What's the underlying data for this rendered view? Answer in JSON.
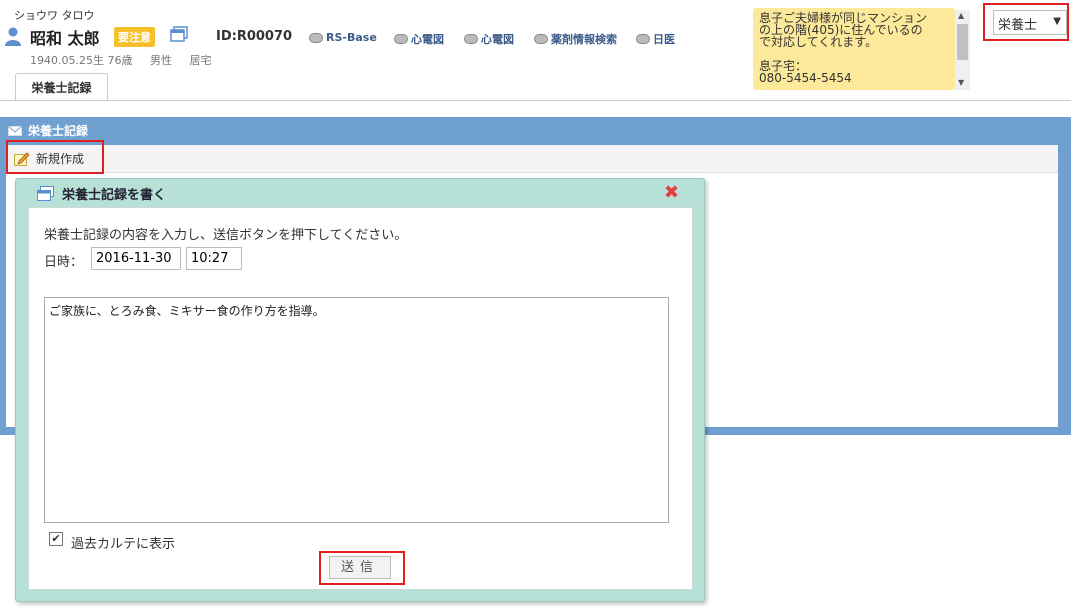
{
  "patient": {
    "kana": "ショウワ タロウ",
    "name": "昭和 太郎",
    "caution_badge": "要注意",
    "id": "ID:R00070",
    "birth": "1940.05.25生 76歳",
    "sex": "男性",
    "residence": "居宅"
  },
  "header_links": [
    "RS-Base",
    "心電図",
    "心電図",
    "薬剤情報検索",
    "日医"
  ],
  "memo": {
    "lines": [
      "息子ご夫婦様が同じマンション",
      "の上の階(405)に住んでいるの",
      "で対応してくれます。",
      "",
      "息子宅：",
      "080-5454-5454"
    ]
  },
  "role_select": {
    "value": "栄養士"
  },
  "tabs": [
    "栄養士記録"
  ],
  "section": {
    "title": "栄養士記録",
    "new_button": "新規作成"
  },
  "dialog": {
    "title": "栄養士記録を書く",
    "instruction": "栄養士記録の内容を入力し、送信ボタンを押下してください。",
    "datetime_label": "日時：",
    "date": "2016-11-30",
    "time": "10:27",
    "content": "ご家族に、とろみ食、ミキサー食の作り方を指導。",
    "show_past_label": "過去カルテに表示",
    "show_past_checked": true,
    "send_label": "送信"
  },
  "colors": {
    "accent_blue": "#6fa0d0",
    "caution": "#f6c02a",
    "memo": "#fde99a",
    "dialog": "#b7e0d6",
    "highlight": "#e02020"
  }
}
